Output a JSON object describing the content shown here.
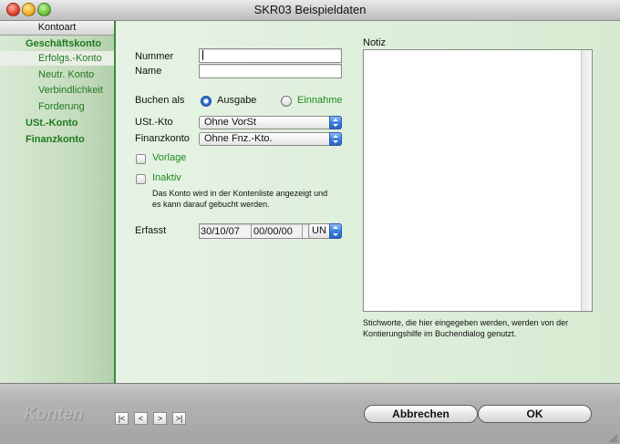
{
  "window": {
    "title": "SKR03 Beispieldaten"
  },
  "sidebar": {
    "header": "Kontoart",
    "items": [
      {
        "label": "Geschäftskonto",
        "bold": true
      },
      {
        "label": "Erfolgs.-Konto",
        "selected": true
      },
      {
        "label": "Neutr. Konto"
      },
      {
        "label": "Verbindlichkeit"
      },
      {
        "label": "Forderung"
      },
      {
        "label": "USt.-Konto",
        "bold": true
      },
      {
        "label": "Finanzkonto",
        "bold": true
      }
    ]
  },
  "form": {
    "nummer_label": "Nummer",
    "nummer_value": "",
    "name_label": "Name",
    "name_value": "",
    "buchen_als_label": "Buchen als",
    "radio_ausgabe": "Ausgabe",
    "radio_einnahme": "Einnahme",
    "radio_selected": "Ausgabe",
    "ust_kto_label": "USt.-Kto",
    "ust_kto_value": "Ohne VorSt",
    "finanzkonto_label": "Finanzkonto",
    "finanzkonto_value": "Ohne Fnz.-Kto.",
    "vorlage_label": "Vorlage",
    "vorlage_checked": false,
    "inaktiv_label": "Inaktiv",
    "inaktiv_checked": false,
    "inaktiv_note_line1": "Das Konto wird in der Kontenliste angezeigt und",
    "inaktiv_note_line2": "es kann darauf gebucht werden.",
    "erfasst_label": "Erfasst",
    "erfasst_date": "30/10/07",
    "erfasst_time": "00/00/00",
    "erfasst_user": "UN"
  },
  "notiz": {
    "label": "Notiz",
    "value": "",
    "help_line1": "Stichworte, die hier eingegeben werden, werden von der",
    "help_line2": "Kontierungshilfe im Buchendialog genutzt."
  },
  "bottombar": {
    "logo": "Konten",
    "nav_first": "|<",
    "nav_prev": "<",
    "nav_next": ">",
    "nav_last": ">|",
    "cancel_label": "Abbrechen",
    "ok_label": "OK"
  },
  "colors": {
    "accent_green": "#1f8a1f",
    "sidebar_border": "#3c8a3a",
    "select_blue": "#3b7fe0"
  }
}
